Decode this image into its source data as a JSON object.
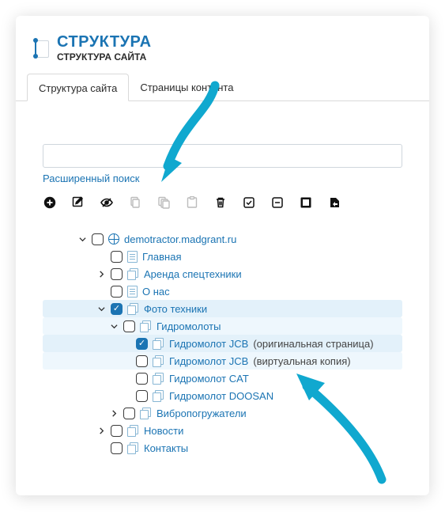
{
  "header": {
    "title": "СТРУКТУРА",
    "subtitle": "СТРУКТУРА САЙТА"
  },
  "tabs": [
    {
      "label": "Структура сайта",
      "active": true
    },
    {
      "label": "Страницы контента",
      "active": false
    }
  ],
  "search": {
    "placeholder": "",
    "advanced_label": "Расширенный поиск"
  },
  "toolbar": [
    {
      "name": "add",
      "title": "Добавить"
    },
    {
      "name": "edit",
      "title": "Редактировать"
    },
    {
      "name": "toggle-visibility",
      "title": "Видимость"
    },
    {
      "name": "copy",
      "title": "Копировать",
      "disabled": true
    },
    {
      "name": "copy-branch",
      "title": "Копировать ветку",
      "disabled": true
    },
    {
      "name": "paste",
      "title": "Вставить",
      "disabled": true
    },
    {
      "name": "delete",
      "title": "Удалить"
    },
    {
      "name": "select-all",
      "title": "Выделить всё"
    },
    {
      "name": "deselect-all",
      "title": "Снять выделение"
    },
    {
      "name": "expand",
      "title": "Развернуть"
    },
    {
      "name": "export",
      "title": "Выгрузить"
    }
  ],
  "tree": {
    "root": {
      "label": "demotractor.madgrant.ru",
      "icon": "globe",
      "checked": false,
      "expanded": true,
      "children": [
        {
          "label": "Главная",
          "icon": "page",
          "checked": false
        },
        {
          "label": "Аренда спецтехники",
          "icon": "stack",
          "checked": false,
          "expandable": true,
          "expanded": false
        },
        {
          "label": "О нас",
          "icon": "page",
          "checked": false
        },
        {
          "label": "Фото техники",
          "icon": "stack",
          "checked": true,
          "selected": true,
          "expandable": true,
          "expanded": true,
          "children": [
            {
              "label": "Гидромолоты",
              "icon": "stack",
              "checked": false,
              "subselect": true,
              "expandable": true,
              "expanded": true,
              "children": [
                {
                  "label": "Гидромолот JCB",
                  "icon": "stack",
                  "checked": true,
                  "selected": true,
                  "suffix": "(оригинальная страница)"
                },
                {
                  "label": "Гидромолот JCB",
                  "icon": "stack",
                  "checked": false,
                  "subselect": true,
                  "suffix": "(виртуальная копия)"
                },
                {
                  "label": "Гидромолот CAT",
                  "icon": "stack",
                  "checked": false
                },
                {
                  "label": "Гидромолот DOOSAN",
                  "icon": "stack",
                  "checked": false
                }
              ]
            },
            {
              "label": "Вибропогружатели",
              "icon": "stack",
              "checked": false,
              "expandable": true,
              "expanded": false
            }
          ]
        },
        {
          "label": "Новости",
          "icon": "stack",
          "checked": false,
          "expandable": true,
          "expanded": false
        },
        {
          "label": "Контакты",
          "icon": "stack",
          "checked": false
        }
      ]
    }
  }
}
